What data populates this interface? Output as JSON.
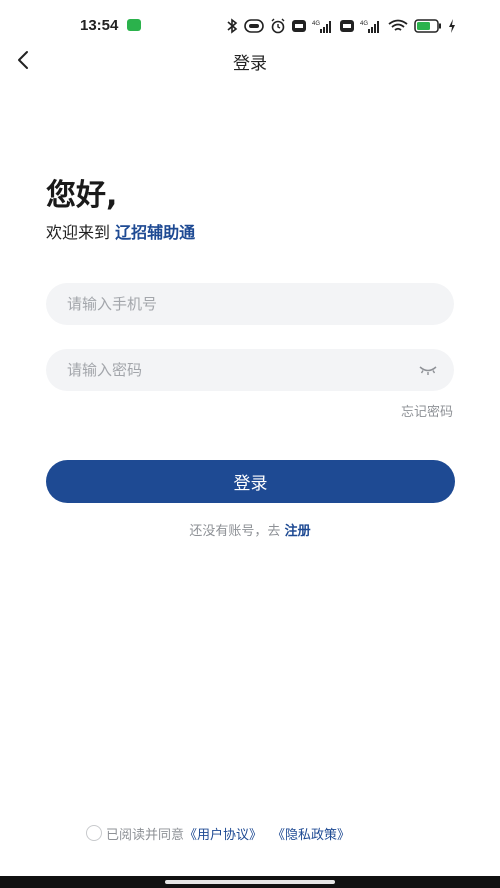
{
  "status_bar": {
    "time": "13:54",
    "icons": [
      "bluetooth-icon",
      "nfc-icon",
      "alarm-icon",
      "hd-icon",
      "signal-icon",
      "hd-icon",
      "signal-icon",
      "wifi-icon",
      "battery-icon",
      "charging-icon"
    ],
    "network_label_1": "4G",
    "network_label_2": "4G",
    "hd_label": "HD",
    "battery_level": "54",
    "badge_color": "#2bb24c"
  },
  "nav": {
    "title": "登录",
    "back_icon": "chevron-left-icon"
  },
  "greeting": {
    "title": "您好,",
    "welcome_prefix": "欢迎来到 ",
    "app_name": "辽招辅助通"
  },
  "form": {
    "phone_placeholder": "请输入手机号",
    "phone_value": "",
    "password_placeholder": "请输入密码",
    "password_value": "",
    "password_toggle_icon": "eye-closed-icon",
    "forgot_password": "忘记密码",
    "login_button": "登录"
  },
  "register": {
    "prompt": "还没有账号，去 ",
    "link": "注册"
  },
  "agreement": {
    "prefix": "已阅读并同意",
    "user_agreement": "《用户协议》",
    "privacy_policy": "《隐私政策》",
    "checked": false
  },
  "colors": {
    "accent": "#1e4a93",
    "input_bg": "#f3f4f6",
    "muted_text": "#8e9196",
    "placeholder": "#a3a6ab"
  }
}
